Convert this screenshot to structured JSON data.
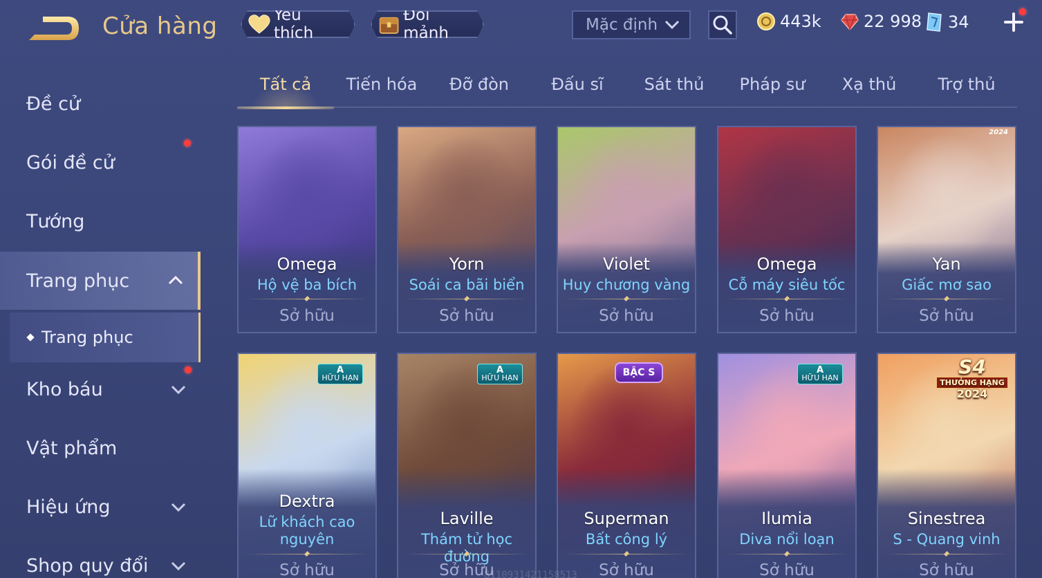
{
  "header": {
    "title": "Cửa hàng",
    "favorite_label": "Yêu thích",
    "exchange_label": "Đổi mảnh",
    "sort_value": "Mặc định"
  },
  "currencies": {
    "gold": "443k",
    "ruby": "22 998",
    "voucher": "34"
  },
  "sidebar": {
    "items": [
      {
        "label": "Đề cử"
      },
      {
        "label": "Gói đề cử"
      },
      {
        "label": "Tướng"
      },
      {
        "label": "Trang phục"
      },
      {
        "label": "Trang phục"
      },
      {
        "label": "Kho báu"
      },
      {
        "label": "Vật phẩm"
      },
      {
        "label": "Hiệu ứng"
      },
      {
        "label": "Shop quy đổi"
      }
    ]
  },
  "tabs": [
    "Tất cả",
    "Tiến hóa",
    "Đỡ đòn",
    "Đấu sĩ",
    "Sát thủ",
    "Pháp sư",
    "Xạ thủ",
    "Trợ thủ"
  ],
  "cards": [
    {
      "hero": "Omega",
      "skin": "Hộ vệ ba bích",
      "status": "Sở hữu",
      "colors": [
        "#8f7ad8",
        "#5a4aa8",
        "#2d2d6e"
      ]
    },
    {
      "hero": "Yorn",
      "skin": "Soái ca bãi biển",
      "status": "Sở hữu",
      "colors": [
        "#d9a882",
        "#8a5f55",
        "#3a3b6a"
      ]
    },
    {
      "hero": "Violet",
      "skin": "Huy chương vàng",
      "status": "Sở hữu",
      "colors": [
        "#a9c76a",
        "#c9a0b0",
        "#4a4f86"
      ]
    },
    {
      "hero": "Omega",
      "skin": "Cỗ máy siêu tốc",
      "status": "Sở hữu",
      "colors": [
        "#b03545",
        "#6b3050",
        "#2a2c5c"
      ]
    },
    {
      "hero": "Yan",
      "skin": "Giấc mơ sao",
      "status": "Sở hữu",
      "badge_year": "2024",
      "colors": [
        "#c98660",
        "#e7d2c8",
        "#5a4a7a"
      ]
    },
    {
      "hero": "Dextra",
      "skin_line1": "Lữ khách cao",
      "skin_line2": "nguyên",
      "status": "Sở hữu",
      "badge_a_top": "A",
      "badge_a_bottom": "HỮU HẠN",
      "colors": [
        "#f1d372",
        "#c9d8ee",
        "#4a6aa8"
      ]
    },
    {
      "hero": "Laville",
      "skin": "Thám tử học đường",
      "status": "Sở hữu",
      "badge_a_top": "A",
      "badge_a_bottom": "HỮU HẠN",
      "colors": [
        "#a88466",
        "#6f4a3a",
        "#3a3052"
      ]
    },
    {
      "hero": "Superman",
      "skin": "Bất công lý",
      "status": "Sở hữu",
      "badge_s": "BẬC S",
      "colors": [
        "#e59a4a",
        "#8a2a3a",
        "#2a2448"
      ]
    },
    {
      "hero": "Ilumia",
      "skin": "Diva nổi loạn",
      "status": "Sở hữu",
      "badge_a_top": "A",
      "badge_a_bottom": "HỮU HẠN",
      "colors": [
        "#a090e0",
        "#f0a8b8",
        "#4a3a8a"
      ]
    },
    {
      "hero": "Sinestrea",
      "skin": "S - Quang vinh",
      "status": "Sở hữu",
      "badge_season_main": "S4",
      "badge_season_rank": "THƯỞNG HẠNG",
      "badge_season_year": "2024",
      "colors": [
        "#f0a060",
        "#f2d8b0",
        "#b04a3a"
      ]
    }
  ],
  "watermark": "8110931421158513",
  "colors": {
    "accent_gold": "#e9c98a",
    "skin_blue": "#7fd4ff",
    "notification": "#ff3b3b"
  }
}
